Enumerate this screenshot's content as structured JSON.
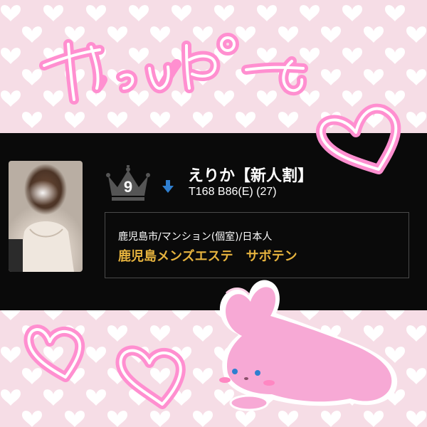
{
  "rank": {
    "number": "9",
    "trend": "down"
  },
  "profile": {
    "name": "えりか【新人割】",
    "stats": "T168 B86(E) (27)",
    "location": "鹿児島市/マンション(個室)/日本人",
    "shop": "鹿児島メンズエステ　サボテン"
  },
  "decor": {
    "handwriting": "やっぴー",
    "background": "pink hearts pattern",
    "stickers": [
      "heart-doodle",
      "heart-doodle",
      "heart-doodle",
      "pink-bunny"
    ]
  },
  "colors": {
    "background_pink": "#f6dde6",
    "heart_white": "#ffffff",
    "doodle_pink": "#ff9ed8",
    "card_black": "#0a0a0a",
    "shop_gold": "#e6b33e",
    "trend_blue": "#2f7fd0",
    "bunny_pink": "#f7a9d5"
  }
}
